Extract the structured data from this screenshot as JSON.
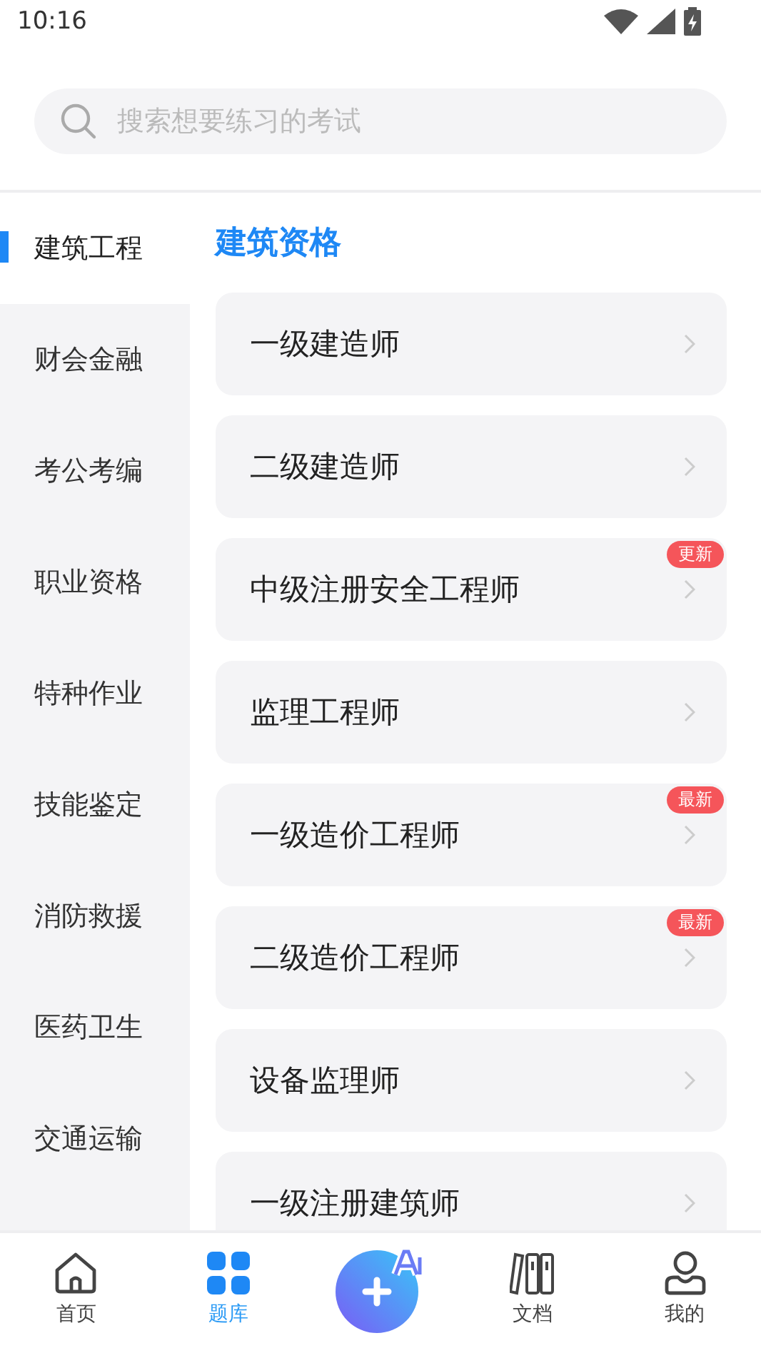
{
  "status_bar": {
    "time": "10:16"
  },
  "search": {
    "placeholder": "搜索想要练习的考试"
  },
  "sidebar": {
    "items": [
      {
        "label": "建筑工程",
        "selected": true
      },
      {
        "label": "财会金融",
        "selected": false
      },
      {
        "label": "考公考编",
        "selected": false
      },
      {
        "label": "职业资格",
        "selected": false
      },
      {
        "label": "特种作业",
        "selected": false
      },
      {
        "label": "技能鉴定",
        "selected": false
      },
      {
        "label": "消防救援",
        "selected": false
      },
      {
        "label": "医药卫生",
        "selected": false
      },
      {
        "label": "交通运输",
        "selected": false
      }
    ]
  },
  "section_title": "建筑资格",
  "exams": [
    {
      "name": "一级建造师"
    },
    {
      "name": "二级建造师"
    },
    {
      "name": "中级注册安全工程师",
      "badge": "更新"
    },
    {
      "name": "监理工程师"
    },
    {
      "name": "一级造价工程师",
      "badge": "最新"
    },
    {
      "name": "二级造价工程师",
      "badge": "最新"
    },
    {
      "name": "设备监理师"
    },
    {
      "name": "一级注册建筑师"
    }
  ],
  "bottom_nav": [
    {
      "kind": "home",
      "label": "首页",
      "selected": false
    },
    {
      "kind": "bank",
      "label": "题库",
      "selected": true
    },
    {
      "kind": "ai"
    },
    {
      "kind": "docs",
      "label": "文档",
      "selected": false
    },
    {
      "kind": "me",
      "label": "我的",
      "selected": false
    }
  ]
}
